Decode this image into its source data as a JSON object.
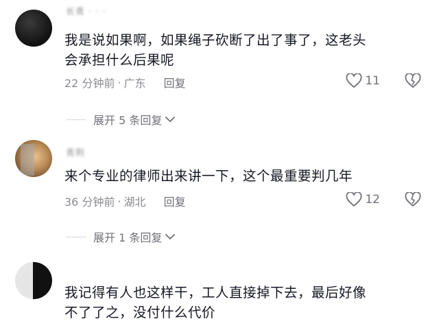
{
  "comments": [
    {
      "username": "长青 · · ·",
      "text_line1": "我是说如果啊，如果绳子砍断了出了事了，这老头",
      "text_line2": "会承担什么后果呢",
      "time": "22 分钟前",
      "location": "广东",
      "reply_label": "回复",
      "likes": "11",
      "expand_label": "展开 5 条回复"
    },
    {
      "username": "青荆",
      "text_line1": "来个专业的律师出来讲一下，这个最重要判几年",
      "time": "36 分钟前",
      "location": "湖北",
      "reply_label": "回复",
      "likes": "12",
      "expand_label": "展开 1 条回复"
    },
    {
      "username": "",
      "text_line1": "我记得有人也这样干，工人直接掉下去，最后好像",
      "text_line2": "不了了之，没付什么代价"
    }
  ],
  "icons": {
    "like": "heart-outline-icon",
    "dislike": "broken-heart-icon",
    "expand": "chevron-down-icon"
  },
  "colors": {
    "text": "#161823",
    "meta": "#8a8b91",
    "background": "#ffffff"
  }
}
